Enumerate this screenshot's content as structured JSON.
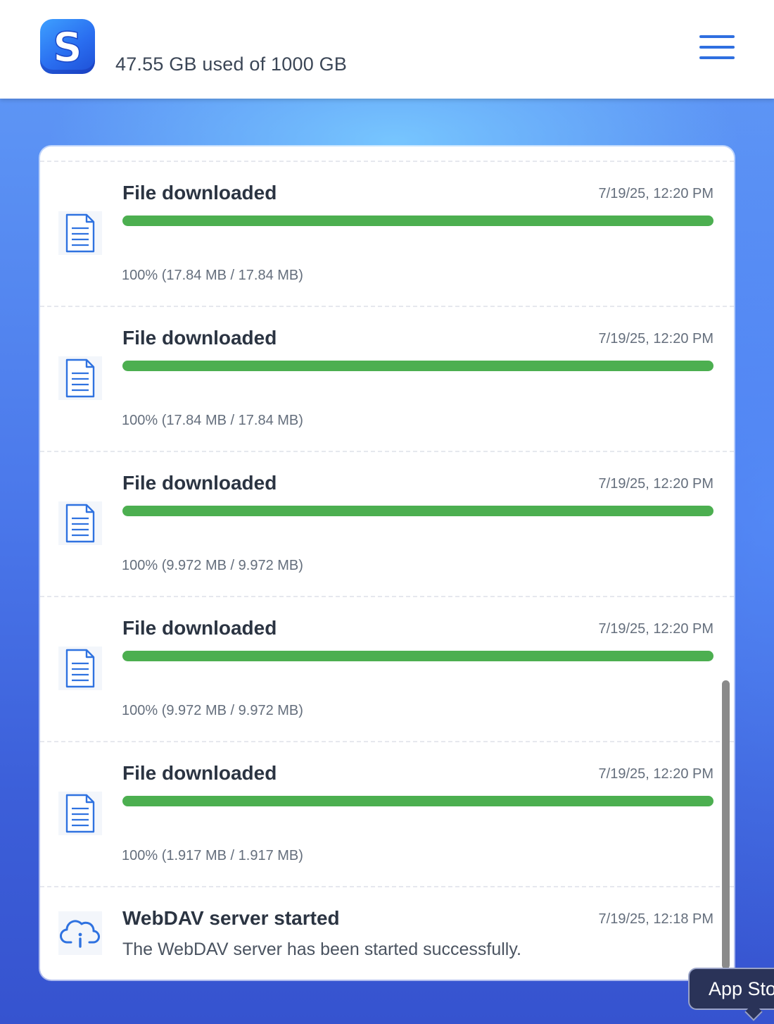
{
  "header": {
    "storage_text": "47.55 GB used of 1000 GB",
    "logo_letter": "S",
    "menu_icon": "hamburger-menu-icon"
  },
  "colors": {
    "accent": "#2f6fe0",
    "progress": "#4caf50"
  },
  "activity": [
    {
      "type": "download",
      "icon": "document-icon",
      "title": "File downloaded",
      "time": "7/19/25, 12:20 PM",
      "percent": 100,
      "progress_text": "100% (17.84 MB / 17.84 MB)"
    },
    {
      "type": "download",
      "icon": "document-icon",
      "title": "File downloaded",
      "time": "7/19/25, 12:20 PM",
      "percent": 100,
      "progress_text": "100% (17.84 MB / 17.84 MB)"
    },
    {
      "type": "download",
      "icon": "document-icon",
      "title": "File downloaded",
      "time": "7/19/25, 12:20 PM",
      "percent": 100,
      "progress_text": "100% (9.972 MB / 9.972 MB)"
    },
    {
      "type": "download",
      "icon": "document-icon",
      "title": "File downloaded",
      "time": "7/19/25, 12:20 PM",
      "percent": 100,
      "progress_text": "100% (9.972 MB / 9.972 MB)"
    },
    {
      "type": "download",
      "icon": "document-icon",
      "title": "File downloaded",
      "time": "7/19/25, 12:20 PM",
      "percent": 100,
      "progress_text": "100% (1.917 MB / 1.917 MB)"
    },
    {
      "type": "server",
      "icon": "cloud-info-icon",
      "title": "WebDAV server started",
      "time": "7/19/25, 12:18 PM",
      "desc": "The WebDAV server has been started successfully."
    }
  ],
  "tooltip": {
    "text": "App Store"
  }
}
